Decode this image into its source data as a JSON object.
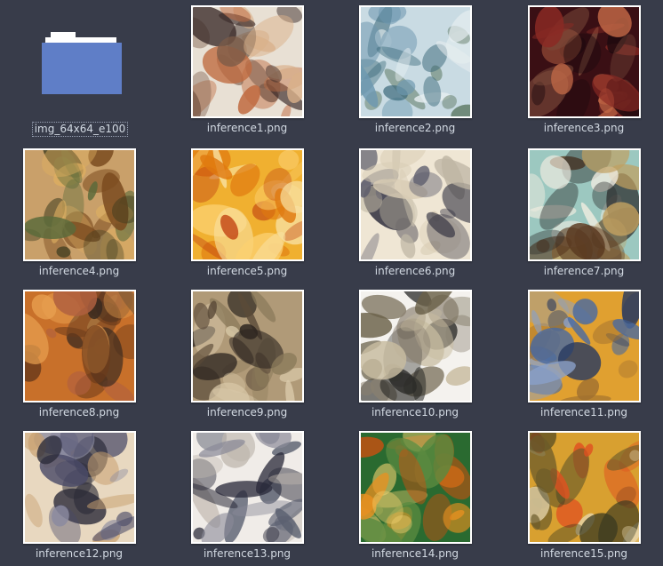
{
  "colors": {
    "background": "#383c4a",
    "label_text": "#d3dae3",
    "folder_blue": "#5f7ec7",
    "thumb_border": "#ffffff"
  },
  "folder": {
    "icon": "folder-icon",
    "name": "img_64x64_e100"
  },
  "files": [
    {
      "name": "inference1.png",
      "palette": [
        "#e8e0d4",
        "#c06a40",
        "#7a5a48",
        "#d9b08a",
        "#3a2a28"
      ]
    },
    {
      "name": "inference2.png",
      "palette": [
        "#c9dbe3",
        "#6e98b0",
        "#3c6a7a",
        "#e6eef0",
        "#4e6a50"
      ]
    },
    {
      "name": "inference3.png",
      "palette": [
        "#3a0f14",
        "#8a2a24",
        "#c46a48",
        "#1e0a0e",
        "#7a4a3a"
      ]
    },
    {
      "name": "inference4.png",
      "palette": [
        "#c9a06a",
        "#7a4a1e",
        "#3a3a1e",
        "#e0b060",
        "#5a6a3a"
      ]
    },
    {
      "name": "inference5.png",
      "palette": [
        "#f0b030",
        "#e07a10",
        "#f8e0a0",
        "#c04010",
        "#fbd070"
      ]
    },
    {
      "name": "inference6.png",
      "palette": [
        "#efe6d4",
        "#d8ccb4",
        "#5a5a6a",
        "#2a2a3a",
        "#bfb6a4"
      ]
    },
    {
      "name": "inference7.png",
      "palette": [
        "#9cc8c0",
        "#5a3a20",
        "#f0ece0",
        "#2a2a2a",
        "#c0a060"
      ]
    },
    {
      "name": "inference8.png",
      "palette": [
        "#c8702a",
        "#6a3a1a",
        "#e8a050",
        "#3a2a20",
        "#b06040"
      ]
    },
    {
      "name": "inference9.png",
      "palette": [
        "#b09a78",
        "#5a4a38",
        "#d8c8a8",
        "#2e2620",
        "#8a7a5a"
      ]
    },
    {
      "name": "inference10.png",
      "palette": [
        "#f4f2ee",
        "#6a6048",
        "#2a2a28",
        "#c8bca0",
        "#8a8070"
      ]
    },
    {
      "name": "inference11.png",
      "palette": [
        "#e0a030",
        "#4a6aa0",
        "#8aa0c8",
        "#a07030",
        "#2a3a60"
      ]
    },
    {
      "name": "inference12.png",
      "palette": [
        "#e8d8c0",
        "#4a4a68",
        "#c8a070",
        "#2a2a38",
        "#8a8aa0"
      ]
    },
    {
      "name": "inference13.png",
      "palette": [
        "#f0ece8",
        "#5a6070",
        "#2a2a3a",
        "#c0b8b0",
        "#8a8a98"
      ]
    },
    {
      "name": "inference14.png",
      "palette": [
        "#2a6a30",
        "#e89020",
        "#c85010",
        "#f0d070",
        "#5a8a40"
      ]
    },
    {
      "name": "inference15.png",
      "palette": [
        "#d8a030",
        "#e05020",
        "#6a5a2a",
        "#e8d8b0",
        "#3a3a20"
      ]
    }
  ]
}
